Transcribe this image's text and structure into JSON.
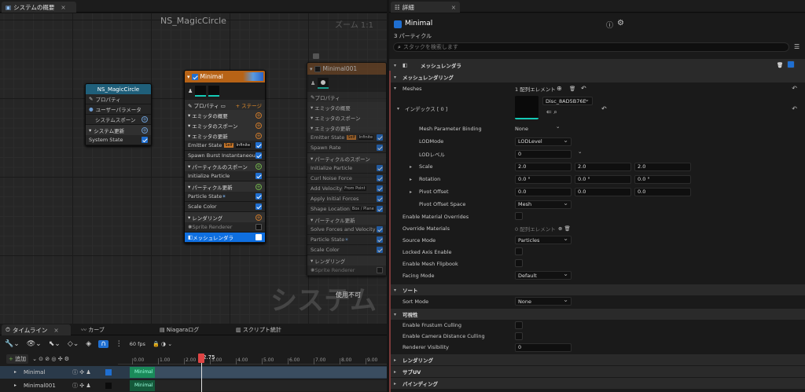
{
  "left_tab": {
    "title": "システムの概要"
  },
  "graph": {
    "title": "NS_MagicCircle",
    "zoom": "ズーム 1:1",
    "watermark": "システム",
    "disabled_label": "使用不可",
    "system_node": {
      "title": "NS_MagicCircle",
      "rows": [
        "プロパティ",
        "ユーザーパラメータ",
        "システムスポーン",
        "システム更新",
        "System State"
      ]
    },
    "minimal_node": {
      "title": "Minimal",
      "props_label": "プロパティ",
      "stage_label": "+ ステージ",
      "rows": [
        {
          "kind": "sec",
          "label": "エミッタの概要"
        },
        {
          "kind": "sec",
          "label": "エミッタのスポーン"
        },
        {
          "kind": "sec",
          "label": "エミッタの更新"
        },
        {
          "kind": "row",
          "label": "Emitter State",
          "tag1": "Self",
          "tag2": "Infinite"
        },
        {
          "kind": "row",
          "label": "Spawn Burst Instantaneous"
        },
        {
          "kind": "sec",
          "label": "パーティクルのスポーン"
        },
        {
          "kind": "row",
          "label": "Initialize Particle"
        },
        {
          "kind": "sec",
          "label": "パーティクル更新"
        },
        {
          "kind": "row",
          "label": "Particle State"
        },
        {
          "kind": "row",
          "label": "Scale Color"
        },
        {
          "kind": "sec",
          "label": "レンダリング"
        },
        {
          "kind": "row",
          "label": "Sprite Renderer"
        },
        {
          "kind": "sel",
          "label": "メッシュレンダラ"
        }
      ]
    },
    "minimal001_node": {
      "title": "Minimal001",
      "props_label": "プロパティ",
      "rows": [
        {
          "kind": "sec",
          "label": "エミッタの概要"
        },
        {
          "kind": "sec",
          "label": "エミッタのスポーン"
        },
        {
          "kind": "sec",
          "label": "エミッタの更新"
        },
        {
          "kind": "row",
          "label": "Emitter State",
          "tag1": "Self",
          "tag2": "Infinite"
        },
        {
          "kind": "row",
          "label": "Spawn Rate"
        },
        {
          "kind": "sec",
          "label": "パーティクルのスポーン"
        },
        {
          "kind": "row",
          "label": "Initialize Particle"
        },
        {
          "kind": "row",
          "label": "Curl Noise Force"
        },
        {
          "kind": "row",
          "label": "Add Velocity",
          "tag2": "From Point"
        },
        {
          "kind": "row",
          "label": "Apply Initial Forces"
        },
        {
          "kind": "row",
          "label": "Shape Location",
          "tag2": "Box / Plane"
        },
        {
          "kind": "sec",
          "label": "パーティクル更新"
        },
        {
          "kind": "row",
          "label": "Solve Forces and Velocity"
        },
        {
          "kind": "row",
          "label": "Particle State"
        },
        {
          "kind": "row",
          "label": "Scale Color"
        },
        {
          "kind": "sec",
          "label": "レンダリング"
        },
        {
          "kind": "row",
          "label": "Sprite Renderer"
        }
      ]
    }
  },
  "details": {
    "tab": "詳細",
    "name": "Minimal",
    "subtitle": "3 パーティクル",
    "search_placeholder": "スタックを検索します",
    "header": "メッシュレンダラ",
    "section_mesh": "メッシュレンダリング",
    "meshes_label": "Meshes",
    "meshes_value": "1 配列エレメント",
    "index_label": "インデックス [ 0 ]",
    "mesh_asset": "Disc_8AD5B76E",
    "rows": {
      "mpb": {
        "label": "Mesh Parameter Binding",
        "value": "None"
      },
      "lodmode": {
        "label": "LODMode",
        "value": "LODLevel"
      },
      "lodlevel": {
        "label": "LODレベル",
        "value": "0"
      },
      "scale": {
        "label": "Scale",
        "x": "2.0",
        "y": "2.0",
        "z": "2.0"
      },
      "rotation": {
        "label": "Rotation",
        "x": "0.0 °",
        "y": "0.0 °",
        "z": "0.0 °"
      },
      "pivot": {
        "label": "Pivot Offset",
        "x": "0.0",
        "y": "0.0",
        "z": "0.0"
      },
      "pivotspace": {
        "label": "Pivot Offset Space",
        "value": "Mesh"
      },
      "emo": {
        "label": "Enable Material Overrides"
      },
      "om": {
        "label": "Override Materials",
        "value": "0 配列エレメント"
      },
      "src": {
        "label": "Source Mode",
        "value": "Particles"
      },
      "lae": {
        "label": "Locked Axis Enable"
      },
      "emf": {
        "label": "Enable Mesh Flipbook"
      },
      "face": {
        "label": "Facing Mode",
        "value": "Default"
      }
    },
    "sort_section": "ソート",
    "sort": {
      "label": "Sort Mode",
      "value": "None"
    },
    "vis_section": "可視性",
    "vis": {
      "frustum": "Enable Frustum Culling",
      "camdist": "Enable Camera Distance Culling",
      "rvis_label": "Renderer Visibility",
      "rvis_value": "0"
    },
    "bottom_sections": [
      "レンダリング",
      "サブUV",
      "バインディング"
    ]
  },
  "timeline": {
    "tabs": [
      "タイムライン",
      "カーブ",
      "Niagaraログ",
      "スクリプト統計"
    ],
    "fps": "60 fps",
    "add": "追加",
    "playhead": "2.75",
    "ticks": [
      "0.00",
      "1.00",
      "2.00",
      "3.00",
      "4.00",
      "5.00",
      "6.00",
      "7.00",
      "8.00",
      "9.00"
    ],
    "tracks": [
      {
        "name": "Minimal",
        "bar": "Minimal"
      },
      {
        "name": "Minimal001",
        "bar": "Minimal"
      }
    ]
  }
}
